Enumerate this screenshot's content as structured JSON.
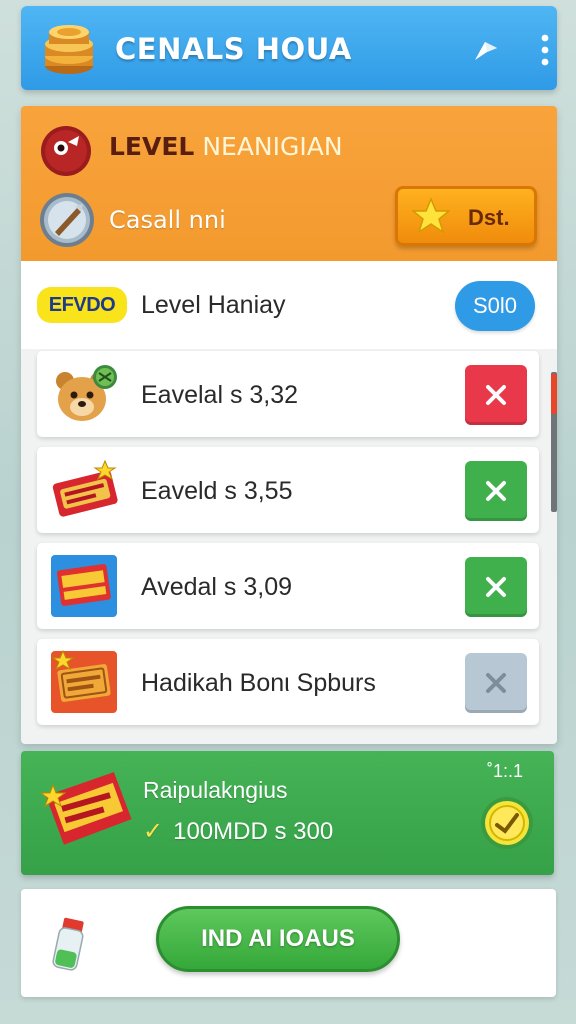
{
  "header": {
    "title": "CENALS HOUA",
    "logo_icon": "coin-stack-icon",
    "share_icon": "share-icon",
    "more_icon": "more-vertical-icon",
    "color": "#2f9ae6"
  },
  "level_card": {
    "title_main": "LEVEL",
    "title_accent": " NEANIGIAN",
    "badge_icon": "bomb-badge-icon",
    "player_name": "Casall nni",
    "avatar_icon": "sword-shield-avatar-icon",
    "action_button": {
      "label": "Dst.",
      "icon": "star-icon"
    },
    "color": "#f39a2e"
  },
  "summary": {
    "badge": "EFVDO",
    "label": "Level Haniay",
    "value": "S0l0"
  },
  "rewards": [
    {
      "label": "Eavelal s 3,32",
      "thumb_icon": "bear-icon",
      "status": "red",
      "button_icon": "close-icon"
    },
    {
      "label": "Eaveld s 3,55",
      "thumb_icon": "candy-pack-icon",
      "status": "green",
      "button_icon": "close-icon"
    },
    {
      "label": "Avedal s 3,09",
      "thumb_icon": "bonus-pack-icon",
      "status": "green",
      "button_icon": "close-icon"
    },
    {
      "label": "Hadikah Bonι Spburs",
      "thumb_icon": "ticket-icon",
      "status": "grey",
      "button_icon": "close-icon"
    }
  ],
  "bonus": {
    "title": "Raipulakngius",
    "subtitle": "100MDD s 300",
    "corner": "˚1:.1",
    "pack_icon": "spurs-pack-icon",
    "coin_icon": "coin-icon",
    "color": "#3fb04c"
  },
  "footer": {
    "cta_label": "IND AI IOAUS",
    "potion_icon": "potion-icon"
  }
}
